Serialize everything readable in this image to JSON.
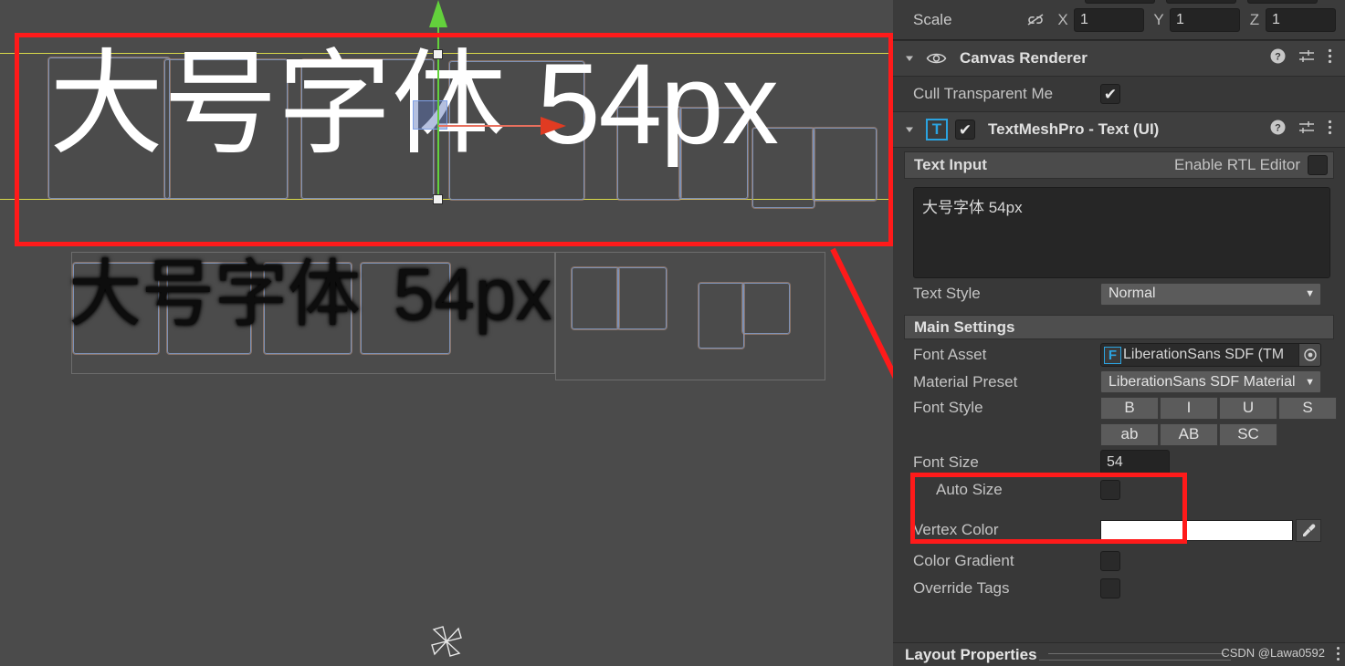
{
  "scene": {
    "main_text": "大号字体 54px",
    "main_text_parts": {
      "cjk": "大号字体",
      "latin": "54px"
    },
    "shadow_text": "大号字体 54px",
    "shadow_text_parts": {
      "cjk": "大号字体",
      "latin": "54px"
    },
    "gizmo": "move-gizmo",
    "pinwheel_icon": "pinwheel-gizmo-icon",
    "annotation_color": "#ff1a1a",
    "guide_color": "#d9d94a",
    "background_color": "#4b4b4b"
  },
  "inspector": {
    "transform": {
      "scale_label": "Scale",
      "link_icon": "broken-link-icon",
      "axes": [
        {
          "letter": "X",
          "value": "1"
        },
        {
          "letter": "Y",
          "value": "1"
        },
        {
          "letter": "Z",
          "value": "1"
        }
      ]
    },
    "canvas_renderer": {
      "title": "Canvas Renderer",
      "icon": "eye-icon",
      "cull_label": "Cull Transparent Me",
      "cull_checked": "✔"
    },
    "textmeshpro": {
      "title": "TextMeshPro - Text (UI)",
      "icon_letter": "T",
      "enabled_check": "✔",
      "text_input": {
        "header": "Text Input",
        "rtl_label": "Enable RTL Editor",
        "rtl_checked": "",
        "value": "大号字体 54px"
      },
      "text_style": {
        "label": "Text Style",
        "value": "Normal"
      },
      "main_settings_label": "Main Settings",
      "font_asset": {
        "label": "Font Asset",
        "badge": "F",
        "value": "LiberationSans SDF (TM"
      },
      "material_preset": {
        "label": "Material Preset",
        "value": "LiberationSans SDF Material"
      },
      "font_style": {
        "label": "Font Style",
        "row1": [
          "B",
          "I",
          "U",
          "S"
        ],
        "row2": [
          "ab",
          "AB",
          "SC"
        ]
      },
      "font_size": {
        "label": "Font Size",
        "value": "54"
      },
      "auto_size": {
        "label": "Auto Size",
        "checked": ""
      },
      "vertex_color": {
        "label": "Vertex Color",
        "value": "#ffffff",
        "eyedropper": "eyedropper-icon"
      },
      "color_gradient": {
        "label": "Color Gradient",
        "checked": ""
      },
      "override_tags": {
        "label": "Override Tags",
        "checked": ""
      }
    },
    "header_icons": {
      "help": "?",
      "preset": "preset-icon",
      "menu": "kebab-menu-icon"
    }
  },
  "footer": {
    "layout_properties": "Layout Properties",
    "watermark": "CSDN @Lawa0592"
  }
}
